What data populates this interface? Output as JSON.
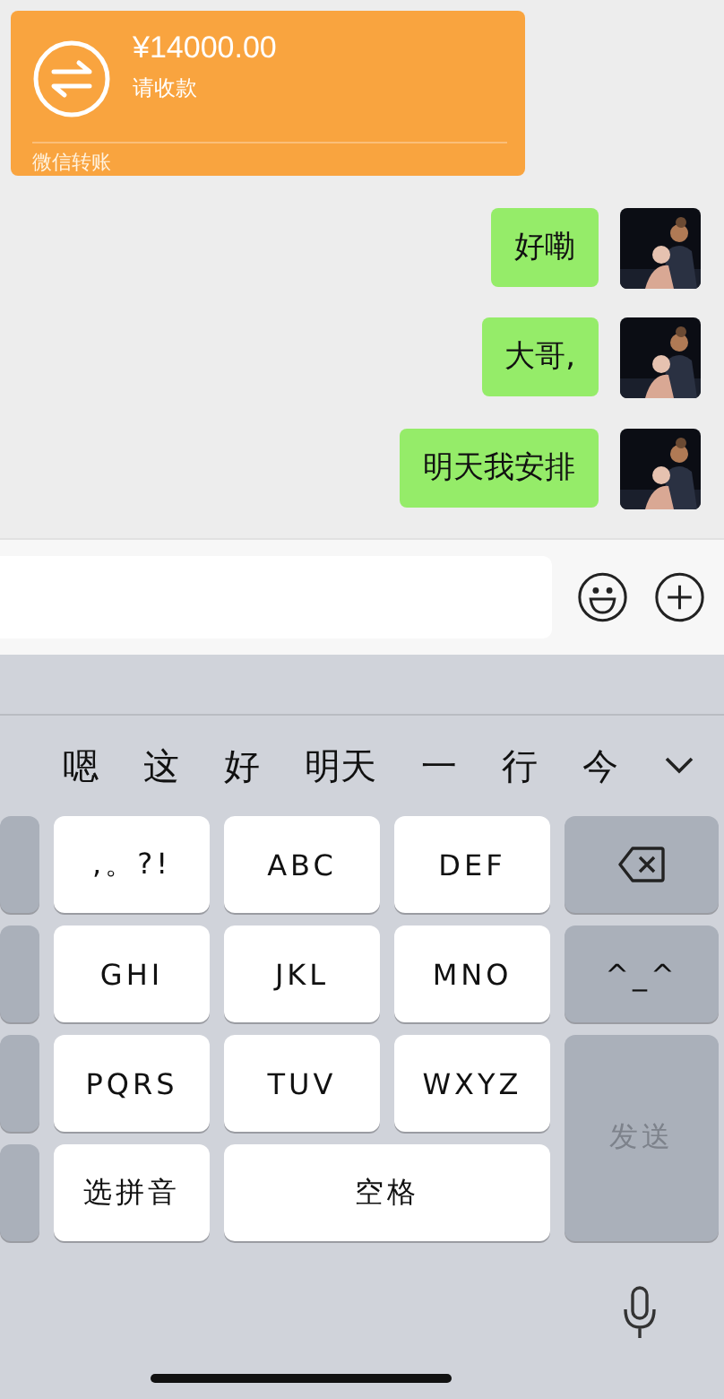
{
  "transfer": {
    "amount": "¥14000.00",
    "note": "请收款",
    "source": "微信转账"
  },
  "messages": [
    {
      "text": "好嘞"
    },
    {
      "text": "大哥,"
    },
    {
      "text": "明天我安排"
    }
  ],
  "candidates": [
    "嗯",
    "这",
    "好",
    "明天",
    "一",
    "行",
    "今"
  ],
  "keys": [
    {
      "kind": "side"
    },
    {
      "kind": "char",
      "label": ",。?!"
    },
    {
      "kind": "char",
      "label": "ABC"
    },
    {
      "kind": "char",
      "label": "DEF"
    },
    {
      "kind": "delete"
    },
    {
      "kind": "side"
    },
    {
      "kind": "char",
      "label": "GHI"
    },
    {
      "kind": "char",
      "label": "JKL"
    },
    {
      "kind": "char",
      "label": "MNO"
    },
    {
      "kind": "symbol",
      "label": "^_^"
    },
    {
      "kind": "side"
    },
    {
      "kind": "char",
      "label": "PQRS"
    },
    {
      "kind": "char",
      "label": "TUV"
    },
    {
      "kind": "char",
      "label": "WXYZ"
    },
    {
      "kind": "send",
      "label": "发送",
      "disabled": true
    },
    {
      "kind": "side"
    },
    {
      "kind": "char",
      "label": "选拼音"
    },
    {
      "kind": "space",
      "label": "空格"
    }
  ]
}
